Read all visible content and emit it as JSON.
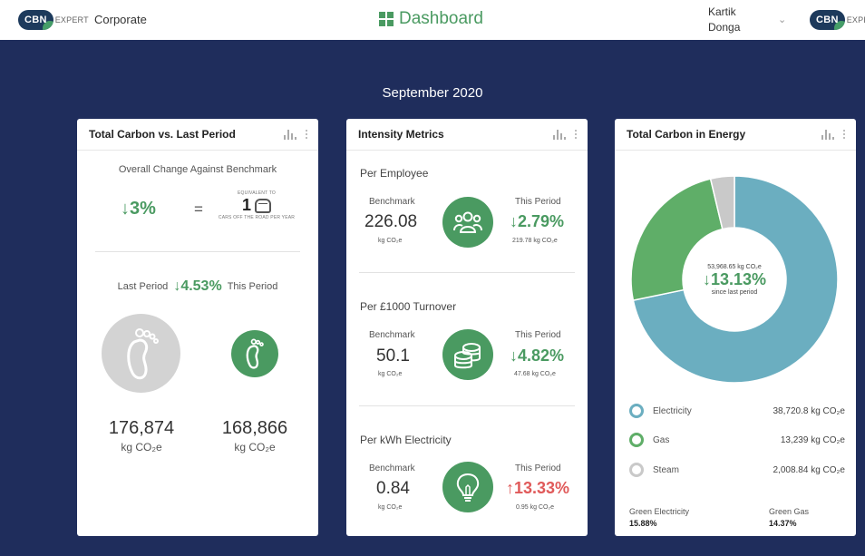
{
  "header": {
    "logo_text": "CBN",
    "logo_word": "EXPERT",
    "org": "Corporate",
    "title": "Dashboard",
    "user_first": "Kartik",
    "user_last": "Donga",
    "chevron": "⌄"
  },
  "period": "September 2020",
  "card1": {
    "title": "Total Carbon vs. Last Period",
    "subtitle": "Overall Change Against Benchmark",
    "change": "↓3%",
    "equals": "=",
    "equiv_top": "EQUIVALENT TO",
    "equiv_value": "1",
    "equiv_bottom": "CARS OFF THE ROAD PER YEAR",
    "last_label": "Last Period",
    "period_change": "↓4.53%",
    "this_label": "This Period",
    "last_value": "176,874",
    "this_value": "168,866",
    "unit": "kg CO₂e"
  },
  "card2": {
    "title": "Intensity Metrics",
    "metrics": [
      {
        "title": "Per Employee",
        "bench_label": "Benchmark",
        "bench_value": "226.08",
        "bench_unit": "kg CO₂e",
        "this_label": "This Period",
        "change": "↓2.79%",
        "this_value": "219.78 kg CO₂e",
        "icon": "people-icon"
      },
      {
        "title": "Per £1000 Turnover",
        "bench_label": "Benchmark",
        "bench_value": "50.1",
        "bench_unit": "kg CO₂e",
        "this_label": "This Period",
        "change": "↓4.82%",
        "this_value": "47.68 kg CO₂e",
        "icon": "coins-icon"
      },
      {
        "title": "Per kWh Electricity",
        "bench_label": "Benchmark",
        "bench_value": "0.84",
        "bench_unit": "kg CO₂e",
        "this_label": "This Period",
        "change": "↑13.33%",
        "this_value": "0.95 kg CO₂e",
        "icon": "lightbulb-icon"
      }
    ]
  },
  "card3": {
    "title": "Total Carbon in Energy",
    "total": "53,968.65 kg CO₂e",
    "change": "↓13.13%",
    "since": "since last period",
    "legend": [
      {
        "label": "Electricity",
        "value": "38,720.8 kg CO₂e",
        "color": "#6baec0",
        "share": 0.7175
      },
      {
        "label": "Gas",
        "value": "13,239 kg CO₂e",
        "color": "#5fae68",
        "share": 0.2453
      },
      {
        "label": "Steam",
        "value": "2,008.84 kg CO₂e",
        "color": "#c9c9c9",
        "share": 0.0372
      }
    ],
    "green_elec_label": "Green Electricity",
    "green_elec_value": "15.88%",
    "green_gas_label": "Green Gas",
    "green_gas_value": "14.37%"
  },
  "colors": {
    "accent": "#4a9a61",
    "negative": "#e05a5a",
    "background": "#1f2d5c"
  }
}
